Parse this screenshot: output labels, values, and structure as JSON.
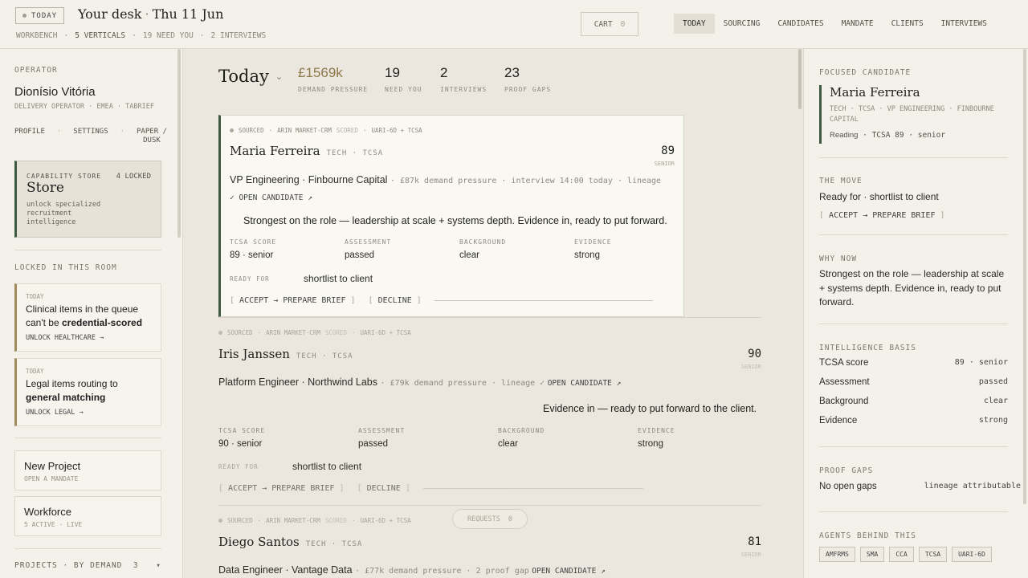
{
  "header": {
    "today_chip": "TODAY",
    "title_left": "Your desk",
    "title_right": "Thu 11 Jun",
    "sub": [
      "WORKBENCH",
      "5 VERTICALS",
      "19 NEED YOU",
      "2 INTERVIEWS"
    ],
    "cart_label": "CART",
    "cart_count": "0",
    "nav": [
      "TODAY",
      "SOURCING",
      "CANDIDATES",
      "MANDATE",
      "CLIENTS",
      "INTERVIEWS"
    ]
  },
  "sidebar": {
    "operator_label": "OPERATOR",
    "operator_name": "Dionísio Vitória",
    "operator_role": "DELIVERY OPERATOR · EMEA · TABRIEF",
    "links": [
      "PROFILE",
      "SETTINGS",
      "PAPER /",
      "DUSK"
    ],
    "store": {
      "label": "CAPABILITY STORE",
      "locked": "4 LOCKED",
      "title": "Store",
      "desc": "unlock specialized recruitment intelligence"
    },
    "locked_label": "LOCKED IN THIS ROOM",
    "locked_cards": [
      {
        "tag": "TODAY",
        "msg_a": "Clinical items in the queue can't be ",
        "msg_b": "credential-scored",
        "action": "UNLOCK HEALTHCARE →"
      },
      {
        "tag": "TODAY",
        "msg_a": "Legal items routing to ",
        "msg_b": "general matching",
        "action": "UNLOCK LEGAL →"
      }
    ],
    "new_project": {
      "title": "New Project",
      "sub": "OPEN A MANDATE"
    },
    "workforce": {
      "title": "Workforce",
      "sub": "5 ACTIVE · LIVE"
    },
    "projects": {
      "label": "PROJECTS · BY DEMAND",
      "count": "3",
      "caret": "▾"
    }
  },
  "main": {
    "title": "Today",
    "kpis": [
      {
        "value": "£1569k",
        "label": "DEMAND PRESSURE"
      },
      {
        "value": "19",
        "label": "NEED YOU"
      },
      {
        "value": "2",
        "label": "INTERVIEWS"
      },
      {
        "value": "23",
        "label": "PROOF GAPS"
      }
    ],
    "stat_labels": [
      "TCSA SCORE",
      "ASSESSMENT",
      "BACKGROUND",
      "EVIDENCE"
    ],
    "ready_label": "READY FOR",
    "accept_label": "ACCEPT → PREPARE BRIEF",
    "decline_label": "DECLINE",
    "requests_label": "REQUESTS",
    "requests_count": "0",
    "candidates": [
      {
        "meta_a": "SOURCED",
        "meta_b": "ARIN MARKET-CRM",
        "meta_c": "SCORED",
        "meta_d": "UARI-6D + TCSA",
        "name": "Maria Ferreira",
        "tags": "TECH · TCSA",
        "score": "89",
        "level": "SENIOR",
        "role": "VP Engineering · Finbourne Capital",
        "role_meta": "£87k demand pressure · interview 14:00 today · lineage",
        "open": "✓ OPEN CANDIDATE ↗",
        "pitch": "Strongest on the role — leadership at scale + systems depth. Evidence in, ready to put forward.",
        "stats": [
          "89 · senior",
          "passed",
          "clear",
          "strong"
        ],
        "ready": "shortlist to client"
      },
      {
        "meta_a": "SOURCED",
        "meta_b": "ARIN MARKET-CRM",
        "meta_c": "SCORED",
        "meta_d": "UARI-6D + TCSA",
        "name": "Iris Janssen",
        "tags": "TECH · TCSA",
        "score": "90",
        "level": "SENIOR",
        "role": "Platform Engineer · Northwind Labs",
        "role_meta": "£79k demand pressure · lineage ✓",
        "open": "OPEN CANDIDATE ↗",
        "pitch": "Evidence in — ready to put forward to the client.",
        "stats": [
          "90 · senior",
          "passed",
          "clear",
          "strong"
        ],
        "ready": "shortlist to client"
      },
      {
        "meta_a": "SOURCED",
        "meta_b": "ARIN MARKET-CRM",
        "meta_c": "SCORED",
        "meta_d": "UARI-6D + TCSA",
        "name": "Diego Santos",
        "tags": "TECH · TCSA",
        "score": "81",
        "level": "SENIOR",
        "role": "Data Engineer · Vantage Data",
        "role_meta": "£77k demand pressure · 2 proof gap",
        "open": "OPEN CANDIDATE ↗"
      }
    ]
  },
  "right": {
    "focused_label": "FOCUSED CANDIDATE",
    "focused_name": "Maria Ferreira",
    "focused_tags": "TECH · TCSA · VP ENGINEERING · FINBOURNE CAPITAL",
    "focused_reading": "Reading",
    "focused_meta": "· TCSA 89 · senior",
    "move_label": "THE MOVE",
    "move_text": "Ready for · shortlist to client",
    "move_action": "ACCEPT → PREPARE BRIEF",
    "why_label": "WHY NOW",
    "why_text": "Strongest on the role — leadership at scale + systems depth. Evidence in, ready to put forward.",
    "basis_label": "INTELLIGENCE BASIS",
    "basis": [
      {
        "k": "TCSA score",
        "v": "89 · senior"
      },
      {
        "k": "Assessment",
        "v": "passed"
      },
      {
        "k": "Background",
        "v": "clear"
      },
      {
        "k": "Evidence",
        "v": "strong"
      }
    ],
    "gaps_label": "PROOF GAPS",
    "gaps_text": "No open gaps",
    "gaps_value": "lineage attributable",
    "agents_label": "AGENTS BEHIND THIS",
    "agents": [
      "AMFRMS",
      "SMA",
      "CCA",
      "TCSA",
      "UARI-6D"
    ]
  },
  "colors": {
    "accent": "#3d5942",
    "gold": "#8d7a4a",
    "bg": "#f4f1eb",
    "center_bg": "#ebe7de"
  }
}
